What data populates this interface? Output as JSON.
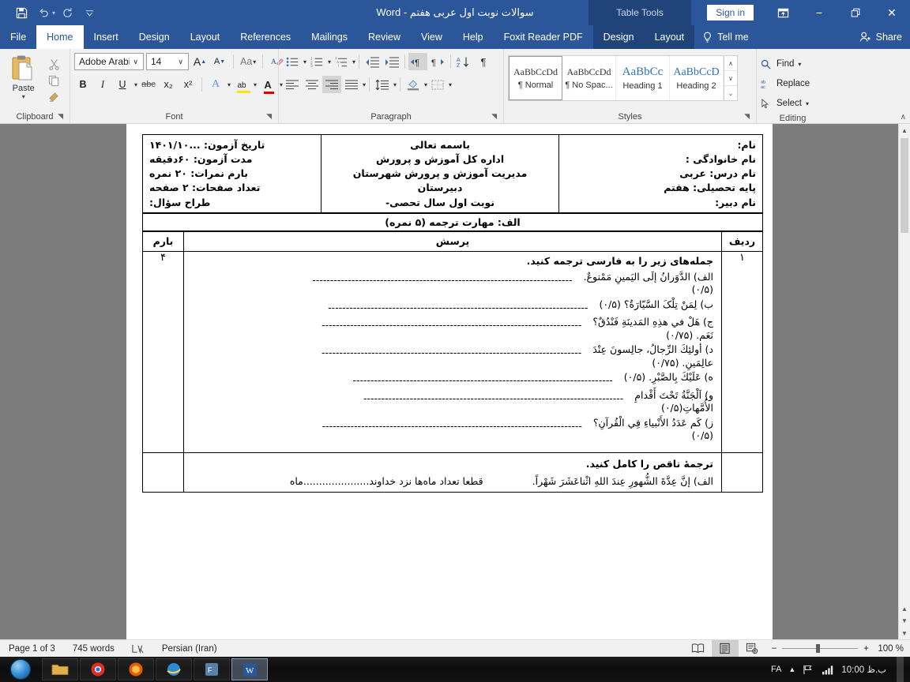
{
  "window": {
    "title_doc": "سوالات نوبت اول عربی هفتم",
    "title_sep": "-",
    "title_app": "Word",
    "table_tools": "Table Tools",
    "sign_in": "Sign in",
    "minimize": "−",
    "restore": "❐",
    "close": "✕"
  },
  "qat": {
    "save": "save-icon",
    "undo": "undo-icon",
    "redo": "redo-icon",
    "customize": "customize-qat-icon"
  },
  "tabs": [
    {
      "label": "File",
      "active": false
    },
    {
      "label": "Home",
      "active": true
    },
    {
      "label": "Insert",
      "active": false
    },
    {
      "label": "Design",
      "active": false
    },
    {
      "label": "Layout",
      "active": false
    },
    {
      "label": "References",
      "active": false
    },
    {
      "label": "Mailings",
      "active": false
    },
    {
      "label": "Review",
      "active": false
    },
    {
      "label": "View",
      "active": false
    },
    {
      "label": "Help",
      "active": false
    },
    {
      "label": "Foxit Reader PDF",
      "active": false
    }
  ],
  "table_tool_tabs": [
    {
      "label": "Design"
    },
    {
      "label": "Layout"
    }
  ],
  "tell_me": "Tell me",
  "share": "Share",
  "ribbon": {
    "clipboard": {
      "group_label": "Clipboard",
      "paste_label": "Paste",
      "cut": "scissors-icon",
      "copy": "copy-icon",
      "format_painter": "format-painter-icon"
    },
    "font": {
      "group_label": "Font",
      "font_name": "Adobe Arabi",
      "font_size": "14",
      "grow": "A",
      "shrink": "A",
      "change_case": "Aa",
      "clear_format": "clear-formatting-icon",
      "bold": "B",
      "italic": "I",
      "underline": "U",
      "strike": "abc",
      "subscript": "x₂",
      "superscript": "x²",
      "text_effects": "A",
      "highlight": "ab",
      "font_color": "A"
    },
    "paragraph": {
      "group_label": "Paragraph",
      "bullets": "bullet-list-icon",
      "numbering": "numbered-list-icon",
      "multilevel": "multilevel-list-icon",
      "decrease_indent": "decrease-indent-icon",
      "increase_indent": "increase-indent-icon",
      "ltr": "left-to-right-icon",
      "rtl": "right-to-left-icon",
      "sort": "sort-icon",
      "show_marks": "¶",
      "align_left": "align-left-icon",
      "align_center": "align-center-icon",
      "align_right": "align-right-icon",
      "justify": "justify-icon",
      "line_spacing": "line-spacing-icon",
      "shading": "shading-icon",
      "borders": "borders-icon"
    },
    "styles": {
      "group_label": "Styles",
      "items": [
        {
          "preview": "AaBbCcDd",
          "name": "¶ Normal",
          "selected": true
        },
        {
          "preview": "AaBbCcDd",
          "name": "¶ No Spac...",
          "selected": false
        },
        {
          "preview": "AaBbCc",
          "name": "Heading 1",
          "selected": false
        },
        {
          "preview": "AaBbCcD",
          "name": "Heading 2",
          "selected": false
        }
      ]
    },
    "editing": {
      "group_label": "Editing",
      "find": "Find",
      "replace": "Replace",
      "select": "Select"
    }
  },
  "document": {
    "header_name_block": [
      "نام:",
      "نام خانوادگی :",
      "نام درس: عربی",
      "پایه تحصیلی: هفتم",
      "نام دبیر:"
    ],
    "header_center_block": [
      "باسمه تعالی",
      "اداره کل آموزش و پرورش",
      "مدیریت آموزش و پرورش شهرستان",
      "دبیرستان",
      "نوبت اول سال تحصی-"
    ],
    "header_info_block": [
      "تاریخ آزمون: ...۱۴۰۱/۱۰",
      "مدت آزمون: ۶۰دقیقه",
      "بارم نمرات: ۲۰ نمره",
      "تعداد صفحات: ۲ صفحه",
      "طراح سؤال:"
    ],
    "section_title": "الف: مهارت ترجمه (۵ نمره)",
    "columns": {
      "radif": "ردیف",
      "porsesh": "پرسش",
      "barem": "بارم"
    },
    "q1": {
      "radif": "۱",
      "barem": "۴",
      "intro": "جمله‌های زیر را به فارسی ترجمه کنید.",
      "items": [
        {
          "text": "الف) الدَّوَرانُ إلَی الیَمینِ مَمْنوعٌ.",
          "score": "(۰/۵)",
          "score_wraps": true
        },
        {
          "text": "ب) لِمَنْ تِلْکَ السَّیّارَةُ؟ (۰/۵)",
          "score": "",
          "score_wraps": false
        },
        {
          "text": "ج) هَلْ في هذِهِ المَدينَةِ فَنْدُقٌ؟",
          "score": "نَعَم. (۰/۷۵)",
          "score_wraps": true
        },
        {
          "text": "د) أولئِكَ الرِّجالُ، جالِسونَ عِنْدَ",
          "score": "عالِمَينِ. (۰/۷۵)",
          "score_wraps": true
        },
        {
          "text": "ه) عَلَيْكَ بِالصَّبْرِ. (۰/۵)",
          "score": "",
          "score_wraps": false
        },
        {
          "text": "و) اَلْجَنَّةُ تَحْتَ أَقْدامِ",
          "score": "الأُمَّهاتِ(۰/۵)",
          "score_wraps": true
        },
        {
          "text": "ز) کَم عَدَدُ الأَنْبیاءِ فِي الْقُرآنِ؟",
          "score": "(۰/۵)",
          "score_wraps": true
        }
      ]
    },
    "q2": {
      "intro": "ترجمهٔ ناقص را کامل کنید.",
      "line_right": "الف) إنَّ عِدَّةَ الشُّهورِ عِندَ اللهِ اثْناعَشَرَ شَهْراً.",
      "line_left_a": "قطعا تعداد ماه‌ها نزد خداوند.....................ماه"
    }
  },
  "status": {
    "page": "Page 1 of 3",
    "words": "745 words",
    "proofing": "proofing-icon",
    "language": "Persian (Iran)",
    "read_mode": "read-mode-icon",
    "print_layout": "print-layout-icon",
    "web_layout": "web-layout-icon",
    "zoom_out": "−",
    "zoom_in": "+",
    "zoom_level": "100 %"
  },
  "taskbar": {
    "start": "start-orb-icon",
    "items": [
      "file-explorer-icon",
      "chrome-icon",
      "firefox-icon",
      "ie-icon",
      "foxit-icon",
      "word-icon"
    ],
    "tray_lang": "FA",
    "tray_up": "▲",
    "tray_flag": "network-flag-icon",
    "tray_signal": "signal-icon",
    "clock": "10:00 ب.ظ"
  }
}
